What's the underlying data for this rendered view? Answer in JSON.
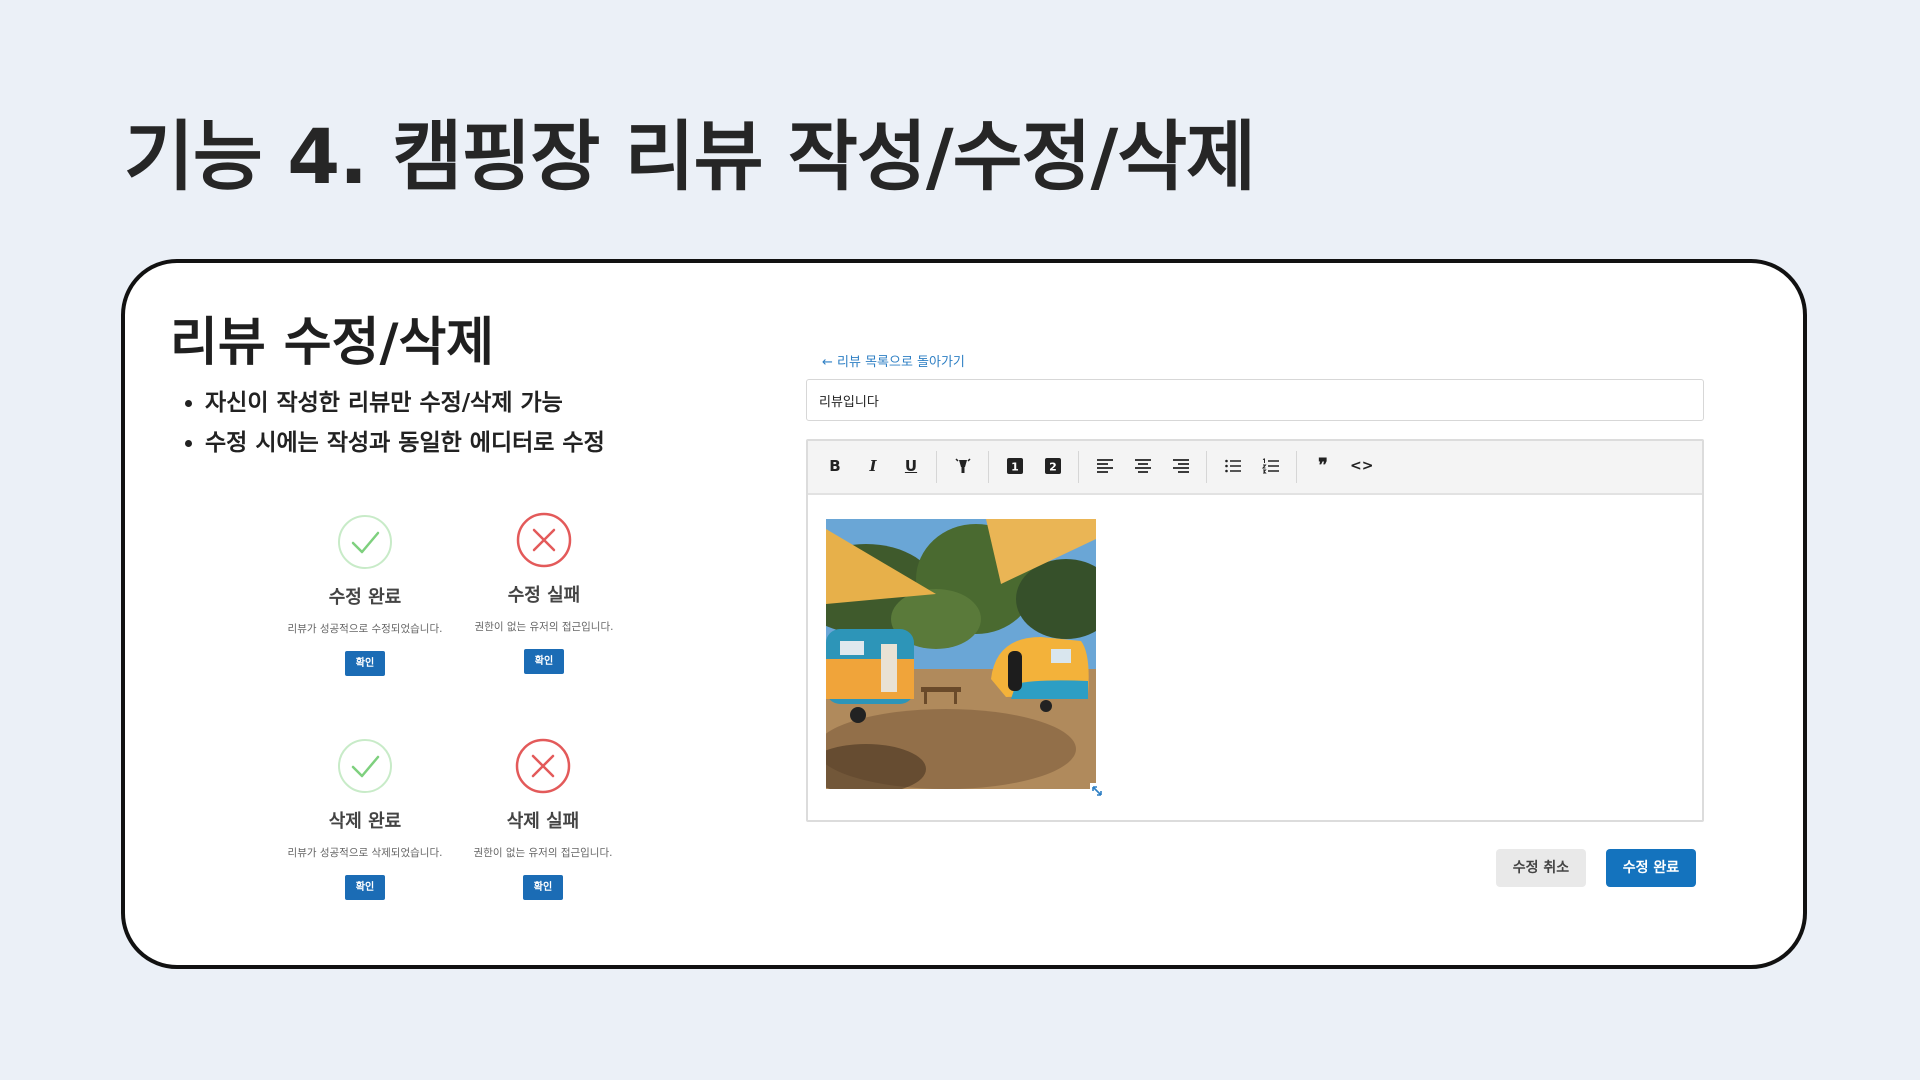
{
  "slide": {
    "title": "기능 4. 캠핑장 리뷰 작성/수정/삭제"
  },
  "card": {
    "title": "리뷰 수정/삭제",
    "bullets": [
      "자신이 작성한 리뷰만 수정/삭제 가능",
      "수정 시에는 작성과 동일한 에디터로 수정"
    ]
  },
  "modals": [
    {
      "status": "success",
      "icon": "check-icon",
      "title": "수정 완료",
      "message": "리뷰가 성공적으로 수정되었습니다.",
      "button": "확인"
    },
    {
      "status": "error",
      "icon": "x-icon",
      "title": "수정 실패",
      "message": "권한이 없는 유저의 접근입니다.",
      "button": "확인"
    },
    {
      "status": "success",
      "icon": "check-icon",
      "title": "삭제 완료",
      "message": "리뷰가 성공적으로 삭제되었습니다.",
      "button": "확인"
    },
    {
      "status": "error",
      "icon": "x-icon",
      "title": "삭제 실패",
      "message": "권한이 없는 유저의 접근입니다.",
      "button": "확인"
    }
  ],
  "editor": {
    "back_link": "← 리뷰 목록으로 돌아가기",
    "title_value": "리뷰입니다",
    "toolbar": [
      "bold-icon",
      "italic-icon",
      "underline-icon",
      "highlight-icon",
      "heading1-icon",
      "heading2-icon",
      "align-left-icon",
      "align-center-icon",
      "align-right-icon",
      "bullet-list-icon",
      "ordered-list-icon",
      "blockquote-icon",
      "code-icon"
    ],
    "image": "campsite-trailers-photo"
  },
  "buttons": {
    "cancel": "수정 취소",
    "submit": "수정 완료"
  },
  "colors": {
    "background": "#ebf0f7",
    "success": "#7ed07e",
    "error": "#e35a5a",
    "primary": "#1473be"
  }
}
